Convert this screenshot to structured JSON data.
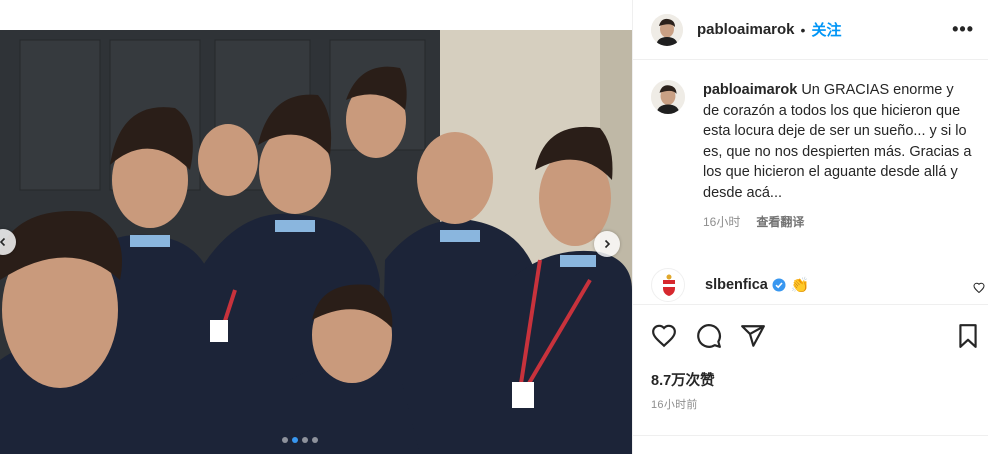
{
  "post": {
    "author": "pabloaimarok",
    "separator": "•",
    "follow_label": "关注",
    "more_label": "•••"
  },
  "caption": {
    "username": "pabloaimarok",
    "text": "Un GRACIAS enorme y de corazón a todos los que hicieron que esta locura deje de ser un sueño... y si lo es, que no nos despierten más. Gracias a los que hicieron el aguante desde allá y desde acá...",
    "time": "16小时",
    "translate_label": "查看翻译"
  },
  "comment": {
    "username": "slbenfica",
    "emoji": "👏",
    "verified": true
  },
  "stats": {
    "likes": "8.7万次赞",
    "posted": "16小时前"
  },
  "carousel": {
    "slide_count": 4,
    "active_index": 1
  },
  "icons": {
    "like": "heart-icon",
    "comment": "comment-icon",
    "share": "share-icon",
    "save": "bookmark-icon",
    "prev": "chevron-left-icon",
    "next": "chevron-right-icon"
  },
  "colors": {
    "follow_blue": "#0095f6",
    "verified_blue": "#3897f0",
    "muted_gray": "#8e8e8e"
  }
}
